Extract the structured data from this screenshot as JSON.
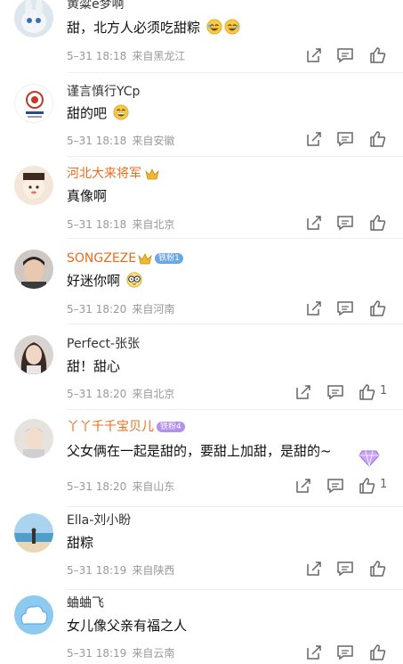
{
  "comments": [
    {
      "user": "黄粱e梦啊",
      "text": "甜，北方人必须吃甜粽",
      "emojis": [
        "laughing-emoji",
        "laughing-emoji"
      ],
      "time": "5–31 18:18",
      "location": "来自黑龙江",
      "likes": ""
    },
    {
      "user": "谨言慎行YCp",
      "text": "甜的吧",
      "emojis": [
        "grinning-emoji"
      ],
      "time": "5–31 18:18",
      "location": "来自安徽",
      "likes": ""
    },
    {
      "user": "河北大来将军",
      "text": "真像啊",
      "emojis": [],
      "time": "5–31 18:18",
      "location": "来自北京",
      "likes": ""
    },
    {
      "user": "SONGZEZE",
      "badge": "铁粉1",
      "text": "好迷你啊",
      "emojis": [
        "glasses-emoji"
      ],
      "time": "5–31 18:20",
      "location": "来自河南",
      "likes": ""
    },
    {
      "user": "Perfect-张张",
      "text": "甜！甜心",
      "emojis": [],
      "time": "5–31 18:20",
      "location": "来自北京",
      "likes": "1"
    },
    {
      "user": "丫丫千千宝贝儿",
      "badge": "铁粉4",
      "text": "父女俩在一起是甜的，要甜上加甜，是甜的~",
      "emojis": [],
      "time": "5–31 18:20",
      "location": "来自山东",
      "likes": "1"
    },
    {
      "user": "Ella-刘小盼",
      "text": "甜粽",
      "emojis": [],
      "time": "5–31 18:19",
      "location": "来自陕西",
      "likes": ""
    },
    {
      "user": "蛐蛐飞",
      "text": "女儿像父亲有福之人",
      "emojis": [],
      "time": "5–31 18:19",
      "location": "来自云南",
      "likes": ""
    }
  ],
  "colors": {
    "orange_name": "#e86e1c",
    "meta": "#999999",
    "badge_blue": "#6aa7e8",
    "badge_purple": "#b38ff0"
  }
}
